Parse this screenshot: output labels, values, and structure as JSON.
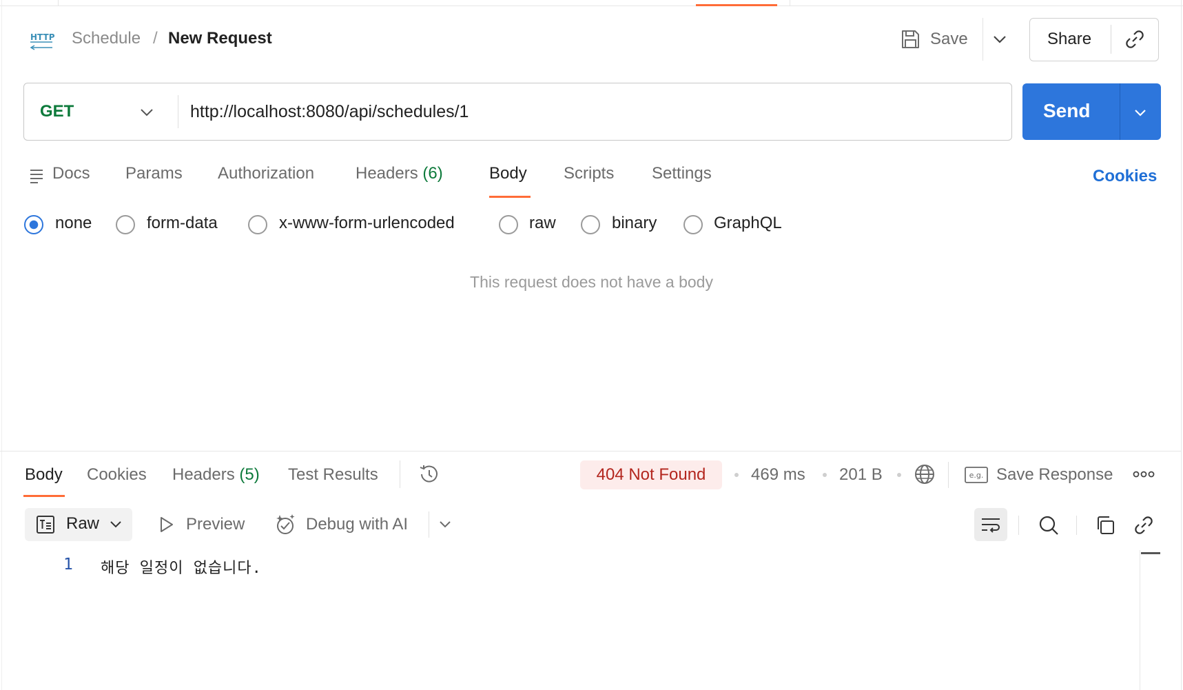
{
  "header": {
    "collection": "Schedule",
    "separator": "/",
    "request_name": "New Request",
    "save_label": "Save",
    "share_label": "Share"
  },
  "request": {
    "method": "GET",
    "url": "http://localhost:8080/api/schedules/1",
    "send_label": "Send",
    "tabs": [
      {
        "label": "Docs"
      },
      {
        "label": "Params"
      },
      {
        "label": "Authorization"
      },
      {
        "label": "Headers",
        "count": "(6)"
      },
      {
        "label": "Body",
        "active": true
      },
      {
        "label": "Scripts"
      },
      {
        "label": "Settings"
      }
    ],
    "cookies_label": "Cookies",
    "body_types": [
      {
        "label": "none",
        "selected": true
      },
      {
        "label": "form-data"
      },
      {
        "label": "x-www-form-urlencoded"
      },
      {
        "label": "raw"
      },
      {
        "label": "binary"
      },
      {
        "label": "GraphQL"
      }
    ],
    "empty_body_message": "This request does not have a body"
  },
  "response": {
    "tabs": [
      {
        "label": "Body",
        "active": true
      },
      {
        "label": "Cookies"
      },
      {
        "label": "Headers",
        "count": "(5)"
      },
      {
        "label": "Test Results"
      }
    ],
    "status": "404 Not Found",
    "time": "469 ms",
    "size": "201 B",
    "save_response_label": "Save Response",
    "eg_label": "e.g.",
    "format_label": "Raw",
    "preview_label": "Preview",
    "debug_label": "Debug with AI",
    "lines": [
      {
        "number": "1",
        "text": "해당 일정이 없습니다."
      }
    ]
  },
  "colors": {
    "accent": "#ff6c37",
    "send_blue": "#2d76dc",
    "method_green": "#0d7a3b",
    "status_red": "#b3261e"
  }
}
